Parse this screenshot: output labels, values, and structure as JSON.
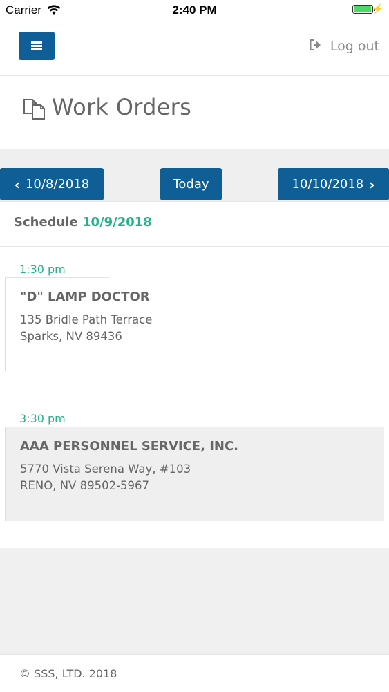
{
  "status_bar": {
    "carrier": "Carrier",
    "time": "2:40 PM",
    "icons": [
      "wifi-icon",
      "battery-icon",
      "charging-bolt-icon"
    ]
  },
  "header": {
    "menu_icon": "hamburger-menu-icon",
    "logout_label": "Log out",
    "logout_icon": "sign-out-icon"
  },
  "page": {
    "title": "Work Orders",
    "title_icon": "documents-icon"
  },
  "date_nav": {
    "prev_label": "10/8/2018",
    "today_label": "Today",
    "next_label": "10/10/2018"
  },
  "schedule": {
    "label": "Schedule",
    "date": "10/9/2018"
  },
  "appointments": [
    {
      "time": "1:30 pm",
      "name": "\"D\" LAMP DOCTOR",
      "address_line1": "135 Bridle Path Terrace",
      "address_line2": "Sparks, NV 89436"
    },
    {
      "time": "3:30 pm",
      "name": "AAA PERSONNEL SERVICE, INC.",
      "address_line1": "5770 Vista Serena Way, #103",
      "address_line2": "RENO, NV 89502-5967"
    }
  ],
  "footer": {
    "copyright": "© SSS, LTD. 2018"
  },
  "colors": {
    "primary": "#0f5f96",
    "accent_green": "#26b089",
    "text_gray": "#666666"
  }
}
